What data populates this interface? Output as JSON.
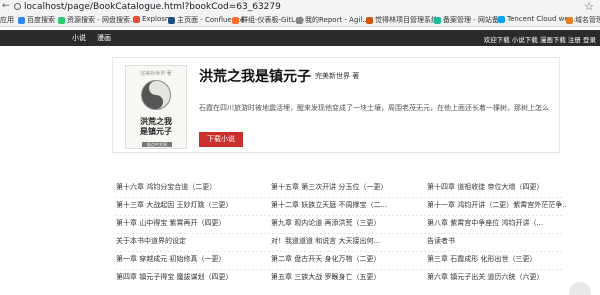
{
  "browser": {
    "url": "localhost/page/BookCatalogue.html?bookCod=63_63279",
    "bookmarks": [
      {
        "label": "应用",
        "color": "#4285f4"
      },
      {
        "label": "百度搜索",
        "color": "#3385ff"
      },
      {
        "label": "资源搜索 - 网盘搜索...",
        "color": "#2ecc71"
      },
      {
        "label": "Explosm",
        "color": "#e74c3c"
      },
      {
        "label": "主页面 - Confluence",
        "color": "#205081"
      },
      {
        "label": "群组-仪表板-GitLab",
        "color": "#fc6d26"
      },
      {
        "label": "我的Report - Agil...",
        "color": "#888888"
      },
      {
        "label": "觉得林项目管理系统",
        "color": "#d35400"
      },
      {
        "label": "备案管理 - 网站备...",
        "color": "#1abc9c"
      },
      {
        "label": "Tencent Cloud we...",
        "color": "#00a4ff"
      },
      {
        "label": "域名管理",
        "color": "#e67e22"
      }
    ]
  },
  "site_nav": {
    "links": [
      "小说",
      "漫画"
    ],
    "welcome": "欢迎下载 小说下载 漫画下载 注册 登录"
  },
  "book": {
    "title": "洪荒之我是镇元子",
    "author": "完美新世界 著",
    "description": "石霞在四川旅游时被地震活埋，醒来发现他变成了一块土壤，周围老茂无元，在他上面还长着一棵树，那树上怎么结的就",
    "download_label": "下载小说",
    "cover": {
      "subtitle": "完美新世界 著",
      "title_line1": "洪荒之我",
      "title_line2": "是镇元子",
      "footer": "起点中文网"
    }
  },
  "chapters": [
    [
      "第十六章 鸿钧分宝合道（二更）",
      "第十五章 第三次开讲 分玉位（一更）",
      "第十四章 道祖收徒 帝位大增（四更）"
    ],
    [
      "第十三章 大战起因 王妙灯跳（三更）",
      "第十二章 妖族立天庭 不周撑宝（二...",
      "第十一章 鸿钧开讲（二更）紫霄宫外茫茫争..."
    ],
    [
      "第十章 山中得宝 紫霄再开（四更）",
      "第九章 观内论道 再添洪荒（三更）",
      "第八章 紫霄宫中争座位 鸿钧开讲（..."
    ],
    [
      "关于本书中道界的设定",
      "对！我道道道 和说言 大天接出何...",
      "告读者书"
    ],
    [
      "第一章 穿越成元 初始修真（一更）",
      "第二章 盘古开天 身化万物（二更）",
      "第三章 石霞成形 化形出世（三更）"
    ],
    [
      "第四章 镇元子得宝 魔拔谋划（四更）",
      "第五章 三族大战 罗睺身亡（五更）",
      "第六章 镇元子出关 道历六统（六更）"
    ]
  ]
}
